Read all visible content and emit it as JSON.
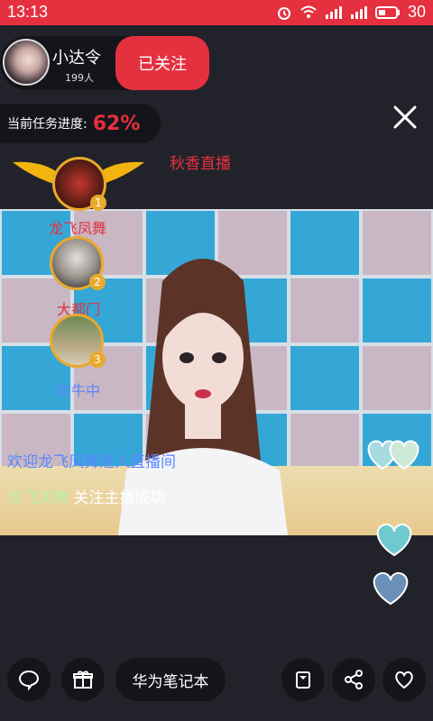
{
  "status_bar": {
    "time": "13:13",
    "battery_level": "30",
    "icons": [
      "alarm-icon",
      "wifi-icon",
      "signal-icon",
      "signal-icon",
      "battery-icon"
    ]
  },
  "anchor": {
    "name": "小达令",
    "viewers": "199人",
    "follow_label": "已关注"
  },
  "task": {
    "label": "当前任务进度:",
    "value": "62%"
  },
  "room": {
    "title": "秋香直播"
  },
  "ranking": [
    {
      "rank": "1",
      "name": "龙飞凤舞"
    },
    {
      "rank": "2",
      "name": "大都门"
    },
    {
      "rank": "3",
      "name": "吹牛中"
    }
  ],
  "chat": [
    {
      "text": "欢迎龙飞凤舞进入直播间"
    },
    {
      "user": "龙飞凤舞",
      "message": "关注主播成功"
    }
  ],
  "toolbar": {
    "gift_label": "华为笔记本",
    "icons": [
      "chat-icon",
      "gift-icon",
      "bag-icon",
      "share-icon",
      "like-heart-icon"
    ]
  },
  "colors": {
    "accent": "#e5303f",
    "background": "#22232a",
    "chat_welcome": "#5b86ff",
    "chat_user": "#b9f0a7"
  }
}
